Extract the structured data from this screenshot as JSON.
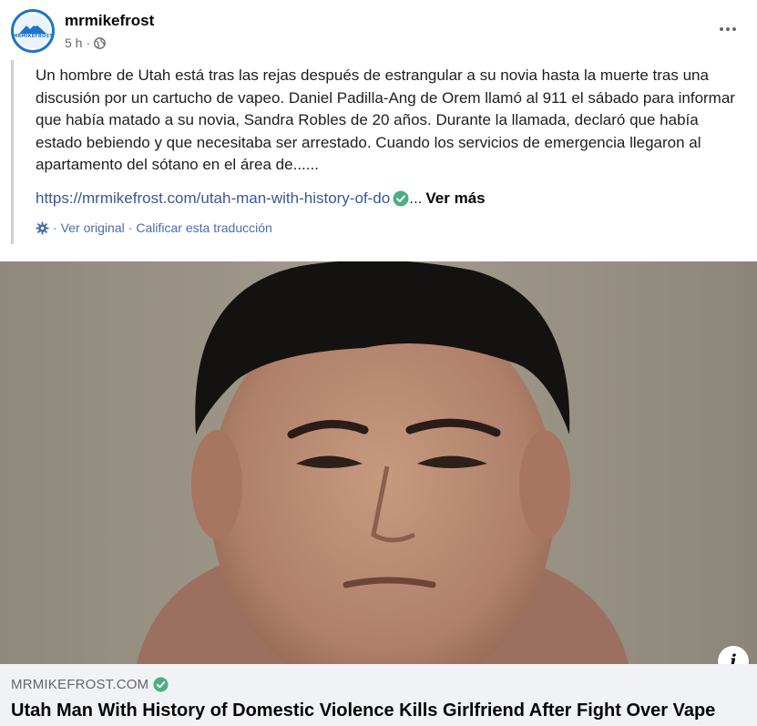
{
  "post": {
    "author": "mrmikefrost",
    "avatar_text": "MRMIKEFROST",
    "time": "5 h",
    "separator": "·",
    "privacy_icon": "globe-icon",
    "menu_icon": "more-options-icon"
  },
  "body": {
    "text": "Un hombre de Utah está tras las rejas después de estrangular a su novia hasta la muerte tras una discusión por un cartucho de vapeo. Daniel Padilla-Ang de Orem llamó al 911 el sábado para informar que había matado a su novia, Sandra Robles de 20 años. Durante la llamada, declaró que había estado bebiendo y que necesitaba ser arrestado. Cuando los servicios de emergencia llegaron al apartamento del sótano en el área de......",
    "link_url": "https://mrmikefrost.com/utah-man-with-history-of-do",
    "ellipsis": "...",
    "see_more": "Ver más",
    "translation_sep1": "·",
    "view_original": "Ver original",
    "translation_sep2": "·",
    "rate_translation": "Calificar esta traducción"
  },
  "link_preview": {
    "domain": "MRMIKEFROST.COM",
    "title": "Utah Man With History of Domestic Violence Kills Girlfriend After Fight Over Vape",
    "info_label": "i"
  },
  "colors": {
    "link": "#385898",
    "translation": "#4a6cae",
    "verified": "#4caf7f",
    "card_bg": "#f0f2f5"
  }
}
